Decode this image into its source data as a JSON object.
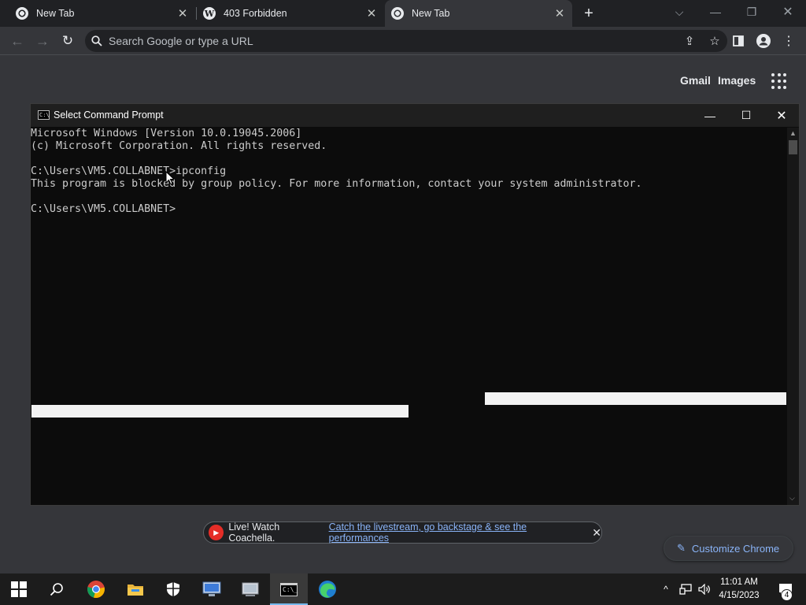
{
  "browser": {
    "tabs": [
      {
        "title": "New Tab",
        "favicon": "chrome-icon",
        "active": false
      },
      {
        "title": "403 Forbidden",
        "favicon": "wordpress-icon",
        "active": false
      },
      {
        "title": "New Tab",
        "favicon": "chrome-icon",
        "active": true
      }
    ],
    "new_tab_symbol": "+",
    "omnibox_placeholder": "Search Google or type a URL"
  },
  "ntp": {
    "gmail": "Gmail",
    "images": "Images",
    "promo": {
      "lead": "Live! Watch Coachella.",
      "link": "Catch the livestream, go backstage & see the performances"
    },
    "customize": "Customize Chrome"
  },
  "cmd": {
    "title": "Select Command Prompt",
    "lines": [
      "Microsoft Windows [Version 10.0.19045.2006]",
      "(c) Microsoft Corporation. All rights reserved.",
      "",
      "C:\\Users\\VM5.COLLABNET>ipconfig",
      "This program is blocked by group policy. For more information, contact your system administrator.",
      "",
      "C:\\Users\\VM5.COLLABNET>"
    ],
    "colors": {
      "background": "#0c0c0c",
      "text": "#cccccc",
      "selection": "#f2f2f2"
    }
  },
  "taskbar": {
    "apps": [
      "start-icon",
      "search-icon",
      "chrome-icon",
      "file-explorer-icon",
      "security-icon",
      "remote-desktop-icon",
      "network-settings-icon",
      "command-prompt-icon",
      "edge-icon"
    ],
    "active_app": "command-prompt-icon",
    "time": "11:01 AM",
    "date": "4/15/2023",
    "notifications": "4"
  }
}
